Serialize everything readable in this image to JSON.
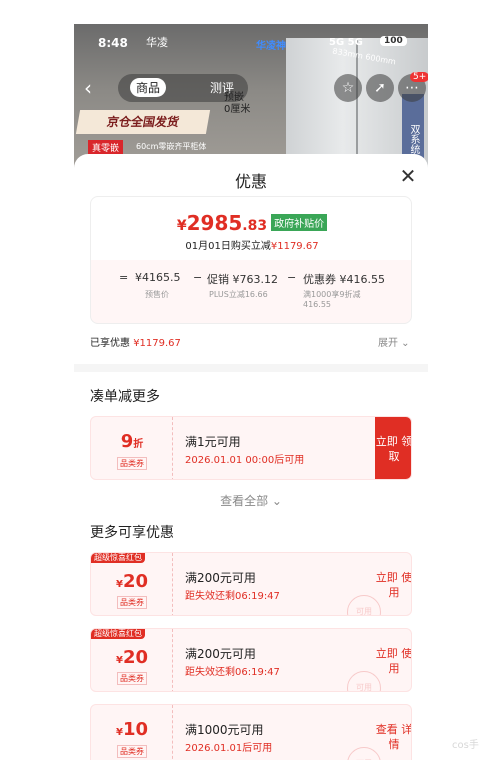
{
  "status_bar": {
    "time": "8:48",
    "brand": "华凌",
    "carrier_blue": "华凌神",
    "network": "5G 5G",
    "battery": "100"
  },
  "header": {
    "tabs": [
      "商品",
      "测评"
    ],
    "promo_banner": "京仓全国发货",
    "promo_tag": "真零嵌",
    "promo_tag_desc": "60cm零嵌齐平柜体",
    "depth_label_top": "预嵌",
    "depth_label_bottom": "0厘米",
    "dimension": "833mm 600mm",
    "side_label": "双系统",
    "cart_badge": "5+"
  },
  "sheet": {
    "title": "优惠",
    "price": {
      "symbol": "¥",
      "integer": "2985",
      "decimal": ".83",
      "tag": "政府补贴价",
      "note_prefix": "01月01日购买立减",
      "note_amount": "¥1179.67"
    },
    "formula": [
      {
        "op": "=",
        "value": "¥4165.5",
        "sub": "预售价"
      },
      {
        "op": "−",
        "value": "促销 ¥763.12",
        "sub": "PLUS立减16.66"
      },
      {
        "op": "−",
        "value": "优惠券 ¥416.55",
        "sub": "满1000享9折减 416.55"
      }
    ],
    "enjoyed_label": "已享优惠",
    "enjoyed_amount": "¥1179.67",
    "expand_label": "展开 ⌄"
  },
  "section1": {
    "title": "凑单减更多",
    "coupons": [
      {
        "amount": "9",
        "unit": "折",
        "type": "品类券",
        "condition": "满1元可用",
        "time": "2026.01.01 00:00后可用",
        "action": "立即 领取"
      }
    ],
    "view_all": "查看全部 ⌄"
  },
  "section2": {
    "title": "更多可享优惠",
    "coupons": [
      {
        "ribbon": "超级惊喜红包",
        "symbol": "¥",
        "amount": "20",
        "type": "品类券",
        "condition": "满200元可用",
        "time": "距失效还剩06:19:47",
        "action": "立即 使用"
      },
      {
        "ribbon": "超级惊喜红包",
        "symbol": "¥",
        "amount": "20",
        "type": "品类券",
        "condition": "满200元可用",
        "time": "距失效还剩06:19:47",
        "action": "立即 使用"
      },
      {
        "ribbon": "",
        "symbol": "¥",
        "amount": "10",
        "type": "品类券",
        "condition": "满1000元可用",
        "time": "2026.01.01后可用",
        "action": "查看 详情"
      }
    ]
  },
  "watermark": "cos手",
  "colors": {
    "accent": "#e02e24",
    "subsidy": "#3aa657"
  }
}
